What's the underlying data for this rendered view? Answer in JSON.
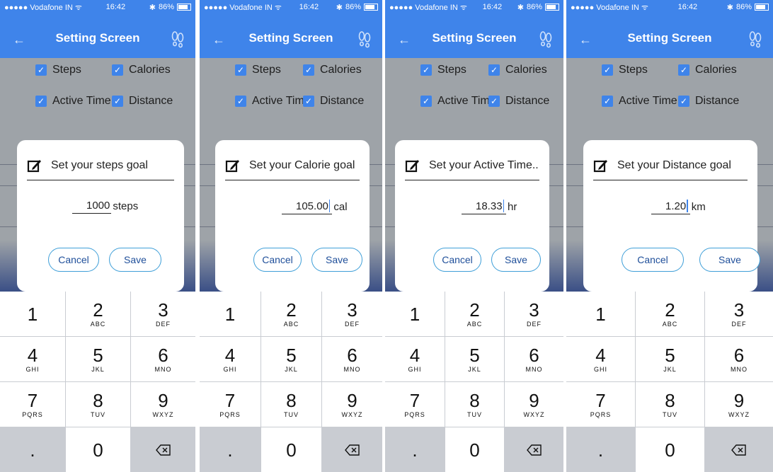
{
  "screens": [
    {
      "status": {
        "carrier": "●●●●● Vodafone IN ᯤ",
        "time": "16:42",
        "battery_text": "86%"
      },
      "nav": {
        "title": "Setting Screen"
      },
      "checkboxes": {
        "steps": "Steps",
        "calories": "Calories",
        "active_time": "Active Time",
        "distance": "Distance"
      },
      "dialog": {
        "title": "Set your steps goal",
        "value": "1000",
        "unit": "steps",
        "cancel": "Cancel",
        "save": "Save"
      }
    },
    {
      "status": {
        "carrier": "●●●●● Vodafone IN ᯤ",
        "time": "16:42",
        "battery_text": "86%"
      },
      "nav": {
        "title": "Setting Screen"
      },
      "checkboxes": {
        "steps": "Steps",
        "calories": "Calories",
        "active_time": "Active Time",
        "distance": "Distance"
      },
      "dialog": {
        "title": "Set your Calorie goal",
        "value": "105.00",
        "unit": "cal",
        "cancel": "Cancel",
        "save": "Save"
      }
    },
    {
      "status": {
        "carrier": "●●●●● Vodafone IN ᯤ",
        "time": "16:42",
        "battery_text": "86%"
      },
      "nav": {
        "title": "Setting Screen"
      },
      "checkboxes": {
        "steps": "Steps",
        "calories": "Calories",
        "active_time": "Active Time",
        "distance": "Distance"
      },
      "dialog": {
        "title": "Set your Active Time...",
        "value": "18.33",
        "unit": "hr",
        "cancel": "Cancel",
        "save": "Save"
      }
    },
    {
      "status": {
        "carrier": "●●●●● Vodafone IN ᯤ",
        "time": "16:42",
        "battery_text": "86%"
      },
      "nav": {
        "title": "Setting Screen"
      },
      "checkboxes": {
        "steps": "Steps",
        "calories": "Calories",
        "active_time": "Active Time",
        "distance": "Distance"
      },
      "dialog": {
        "title": "Set your Distance goal",
        "value": "1.20",
        "unit": "km",
        "cancel": "Cancel",
        "save": "Save"
      }
    }
  ],
  "keypad": {
    "keys": [
      {
        "num": "1",
        "letters": ""
      },
      {
        "num": "2",
        "letters": "ABC"
      },
      {
        "num": "3",
        "letters": "DEF"
      },
      {
        "num": "4",
        "letters": "GHI"
      },
      {
        "num": "5",
        "letters": "JKL"
      },
      {
        "num": "6",
        "letters": "MNO"
      },
      {
        "num": "7",
        "letters": "PQRS"
      },
      {
        "num": "8",
        "letters": "TUV"
      },
      {
        "num": "9",
        "letters": "WXYZ"
      },
      {
        "num": ".",
        "letters": ""
      },
      {
        "num": "0",
        "letters": ""
      }
    ]
  },
  "icons": {
    "back": "arrow-left-icon",
    "nav_right": "footprints-icon",
    "edit": "edit-icon",
    "delete": "backspace-icon",
    "checkbox": "check-icon"
  },
  "colors": {
    "primary": "#3f84ea",
    "button_border": "#3f9fd8",
    "overlay": "#9ea3a8",
    "keypad_dark": "#c9ccd2"
  }
}
